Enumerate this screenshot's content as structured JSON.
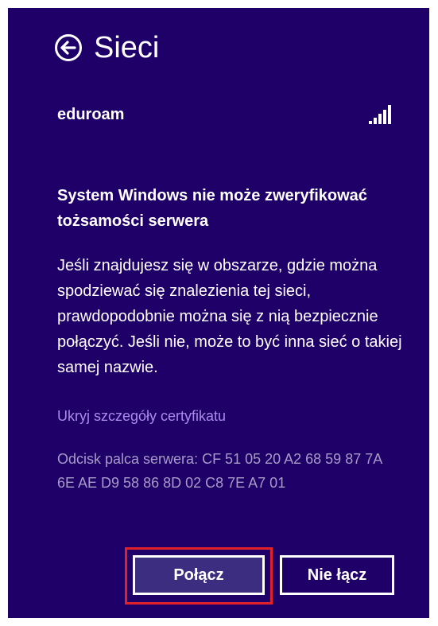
{
  "header": {
    "title": "Sieci",
    "back_icon": "back-arrow-circle-icon"
  },
  "network": {
    "name": "eduroam",
    "signal_icon": "wifi-signal-icon",
    "signal_level": "full"
  },
  "message": {
    "heading": "System Windows nie może zweryfikować tożsamości serwera",
    "body": "Jeśli znajdujesz się w obszarze, gdzie można spodziewać się znalezienia tej sieci, prawdopodobnie można się z nią bezpiecznie połączyć. Jeśli nie, może to być inna sieć o takiej samej nazwie."
  },
  "certificate": {
    "toggle_label": "Ukryj szczegóły certyfikatu",
    "fingerprint_text": "Odcisk palca serwera: CF 51 05 20 A2 68 59 87 7A 6E AE D9 58 86 8D 02 C8 7E A7 01"
  },
  "buttons": {
    "connect_label": "Połącz",
    "cancel_label": "Nie łącz"
  },
  "colors": {
    "background": "#1f0068",
    "link": "#a98ce8",
    "muted_text": "#a79bc7",
    "connect_button": "#3d2d80",
    "highlight_border": "#e0202a"
  }
}
